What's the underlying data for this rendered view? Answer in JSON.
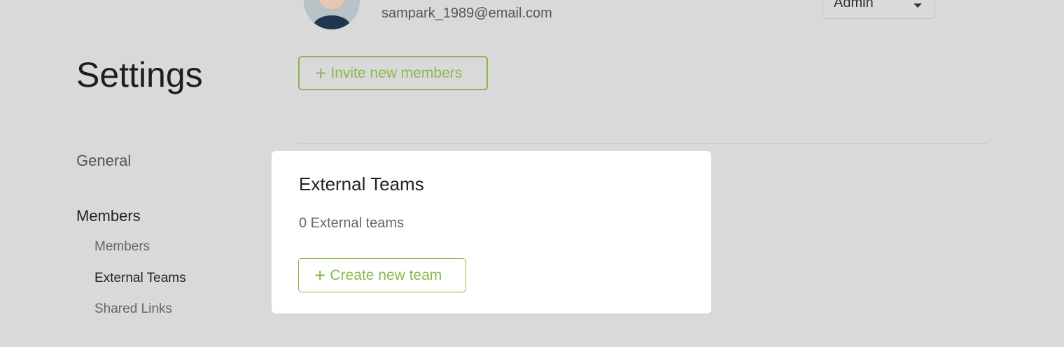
{
  "user": {
    "email": "sampark_1989@email.com",
    "role": "Admin"
  },
  "page": {
    "title": "Settings",
    "invite_label": "Invite new members"
  },
  "sidebar": {
    "general": "General",
    "members_section": "Members",
    "items": [
      {
        "label": "Members"
      },
      {
        "label": "External Teams"
      },
      {
        "label": "Shared Links"
      }
    ]
  },
  "card": {
    "title": "External Teams",
    "count": "0 External teams",
    "create_label": "Create new team"
  },
  "colors": {
    "accent": "#8ab84f",
    "background": "#d9d9d9"
  }
}
